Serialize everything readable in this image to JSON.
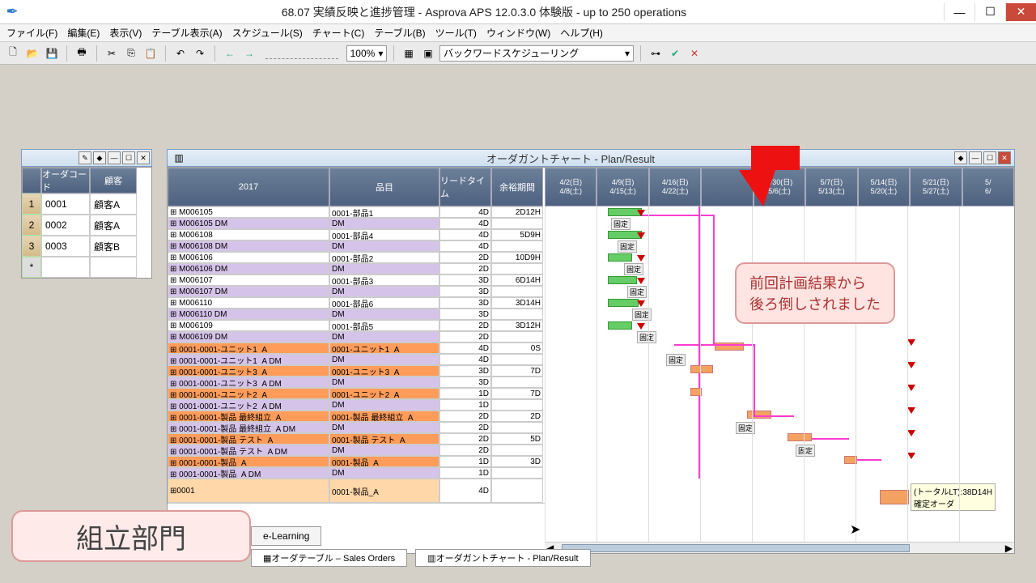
{
  "title": "68.07 実績反映と進捗管理 - Asprova APS 12.0.3.0 体験版  - up to 250 operations",
  "menus": [
    "ファイル(F)",
    "編集(E)",
    "表示(V)",
    "テーブル表示(A)",
    "スケジュール(S)",
    "チャート(C)",
    "テーブル(B)",
    "ツール(T)",
    "ウィンドウ(W)",
    "ヘルプ(H)"
  ],
  "zoom": "100%",
  "sched_mode": "バックワードスケジューリング",
  "left_headers": [
    "オーダコード",
    "顧客"
  ],
  "orders": [
    {
      "n": "1",
      "code": "0001",
      "cust": "顧客A"
    },
    {
      "n": "2",
      "code": "0002",
      "cust": "顧客A"
    },
    {
      "n": "3",
      "code": "0003",
      "cust": "顧客B"
    }
  ],
  "gantt_title": "オーダガントチャート - Plan/Result",
  "col_headers": {
    "year": "2017",
    "item": "品目",
    "lead": "リードタイム",
    "slack": "余裕期間"
  },
  "date_headers": [
    {
      "a": "4/2(日)",
      "b": "4/8(土)"
    },
    {
      "a": "4/9(日)",
      "b": "4/15(土)"
    },
    {
      "a": "4/16(日)",
      "b": "4/22(土)"
    },
    {
      "a": "",
      "b": ""
    },
    {
      "a": "4/30(日)",
      "b": "5/6(土)"
    },
    {
      "a": "5/7(日)",
      "b": "5/13(土)"
    },
    {
      "a": "5/14(日)",
      "b": "5/20(土)"
    },
    {
      "a": "5/21(日)",
      "b": "5/27(土)"
    },
    {
      "a": "5/",
      "b": "6/"
    }
  ],
  "rows": [
    {
      "c": "w",
      "id": "M006105",
      "item": "0001-部品1",
      "lt": "4D",
      "sl": "2D12H"
    },
    {
      "c": "l",
      "id": "M006105 DM",
      "item": "DM",
      "lt": "4D",
      "sl": ""
    },
    {
      "c": "w",
      "id": "M006108",
      "item": "0001-部品4",
      "lt": "4D",
      "sl": "5D9H"
    },
    {
      "c": "l",
      "id": "M006108 DM",
      "item": "DM",
      "lt": "4D",
      "sl": ""
    },
    {
      "c": "w",
      "id": "M006106",
      "item": "0001-部品2",
      "lt": "2D",
      "sl": "10D9H"
    },
    {
      "c": "l",
      "id": "M006106 DM",
      "item": "DM",
      "lt": "2D",
      "sl": ""
    },
    {
      "c": "w",
      "id": "M006107",
      "item": "0001-部品3",
      "lt": "3D",
      "sl": "6D14H"
    },
    {
      "c": "l",
      "id": "M006107 DM",
      "item": "DM",
      "lt": "3D",
      "sl": ""
    },
    {
      "c": "w",
      "id": "M006110",
      "item": "0001-部品6",
      "lt": "3D",
      "sl": "3D14H"
    },
    {
      "c": "l",
      "id": "M006110 DM",
      "item": "DM",
      "lt": "3D",
      "sl": ""
    },
    {
      "c": "w",
      "id": "M006109",
      "item": "0001-部品5",
      "lt": "2D",
      "sl": "3D12H"
    },
    {
      "c": "l",
      "id": "M006109 DM",
      "item": "DM",
      "lt": "2D",
      "sl": ""
    },
    {
      "c": "o",
      "id": "0001-0001-ユニット1_A",
      "item": "0001-ユニット1_A",
      "lt": "4D",
      "sl": "0S"
    },
    {
      "c": "l",
      "id": "0001-0001-ユニット1_A DM",
      "item": "DM",
      "lt": "4D",
      "sl": ""
    },
    {
      "c": "o",
      "id": "0001-0001-ユニット3_A",
      "item": "0001-ユニット3_A",
      "lt": "3D",
      "sl": "7D"
    },
    {
      "c": "l",
      "id": "0001-0001-ユニット3_A DM",
      "item": "DM",
      "lt": "3D",
      "sl": ""
    },
    {
      "c": "o",
      "id": "0001-0001-ユニット2_A",
      "item": "0001-ユニット2_A",
      "lt": "1D",
      "sl": "7D"
    },
    {
      "c": "l",
      "id": "0001-0001-ユニット2_A DM",
      "item": "DM",
      "lt": "1D",
      "sl": ""
    },
    {
      "c": "o",
      "id": "0001-0001-製品 最終組立_A",
      "item": "0001-製品 最終組立_A",
      "lt": "2D",
      "sl": "2D"
    },
    {
      "c": "l",
      "id": "0001-0001-製品 最終組立_A DM",
      "item": "DM",
      "lt": "2D",
      "sl": ""
    },
    {
      "c": "o",
      "id": "0001-0001-製品 テスト_A",
      "item": "0001-製品 テスト_A",
      "lt": "2D",
      "sl": "5D"
    },
    {
      "c": "l",
      "id": "0001-0001-製品 テスト_A DM",
      "item": "DM",
      "lt": "2D",
      "sl": ""
    },
    {
      "c": "o",
      "id": "0001-0001-製品_A",
      "item": "0001-製品_A",
      "lt": "1D",
      "sl": "3D"
    },
    {
      "c": "l",
      "id": "0001-0001-製品_A DM",
      "item": "DM",
      "lt": "1D",
      "sl": ""
    }
  ],
  "summary": {
    "id": "0001",
    "item": "0001-製品_A",
    "lt": "4D"
  },
  "callout": "前回計画結果から\n後ろ倒しされました",
  "big_label": "組立部門",
  "btab": "e-Learning",
  "dtabs": [
    "オーダテーブル – Sales Orders",
    "オーダガントチャート - Plan/Result"
  ],
  "tooltip": "(トータルLT):38D14H\n確定オーダ",
  "fixed": "固定"
}
